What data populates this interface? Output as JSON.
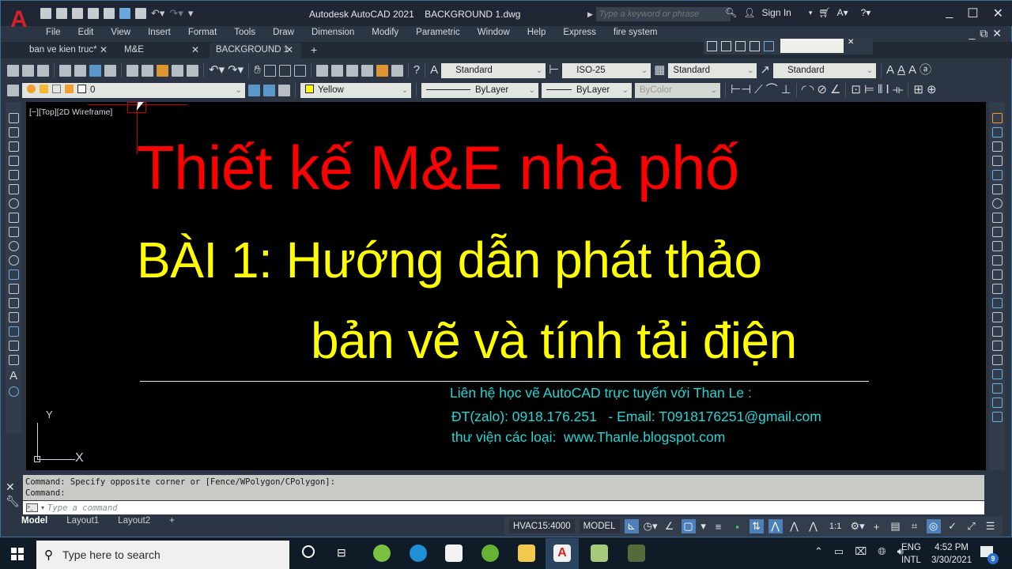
{
  "app": {
    "logo": "A",
    "title": "Autodesk AutoCAD 2021    BACKGROUND 1.dwg",
    "search_placeholder": "Type a keyword or phrase",
    "sign_in": "Sign In"
  },
  "menu": [
    "File",
    "Edit",
    "View",
    "Insert",
    "Format",
    "Tools",
    "Draw",
    "Dimension",
    "Modify",
    "Parametric",
    "Window",
    "Help",
    "Express",
    "fire system"
  ],
  "tabs": [
    {
      "label": "ban ve kien truc*",
      "active": false
    },
    {
      "label": "M&E",
      "active": false
    },
    {
      "label": "BACKGROUND 1",
      "active": true
    }
  ],
  "tab_add": "+",
  "toolbar": {
    "text_style": "Standard",
    "dim_style": "ISO-25",
    "table_style": "Standard",
    "mleader_style": "Standard",
    "layer": "0",
    "color": "Yellow",
    "color_hex": "#ffff00",
    "linetype": "ByLayer",
    "lineweight": "ByLayer",
    "plotstyle": "ByColor"
  },
  "viewport": {
    "label": "[−][Top][2D Wireframe]",
    "ucs_y": "Y",
    "ucs_x": "X"
  },
  "drawing": {
    "title": "Thiết kế M&E nhà phố",
    "subtitle_line1": "BÀI 1: Hướng dẫn phát thảo",
    "subtitle_line2": "bản vẽ và tính tải điện",
    "contact_line1": "Liên hệ học vẽ AutoCAD trực tuyến với Than Le :",
    "contact_line2": "ĐT(zalo): 0918.176.251   - Email: T0918176251@gmail.com",
    "contact_line3": "thư viện các loại:  www.Thanle.blogspot.com",
    "colors": {
      "title": "#ff0000",
      "subtitle": "#ffff00",
      "contact": "#22d6d6"
    }
  },
  "command": {
    "history1": "Command: Specify opposite corner or [Fence/WPolygon/CPolygon]:",
    "history2": "Command:",
    "placeholder": "Type a command"
  },
  "layout_tabs": [
    "Model",
    "Layout1",
    "Layout2"
  ],
  "layout_add": "+",
  "status": {
    "scale_name": "HVAC15:4000",
    "space": "MODEL",
    "annotation_scale": "1:1"
  },
  "taskbar": {
    "search_placeholder": "Type here to search",
    "lang1": "ENG",
    "lang2": "INTL",
    "time": "4:52 PM",
    "date": "3/30/2021",
    "notifications": "9"
  }
}
